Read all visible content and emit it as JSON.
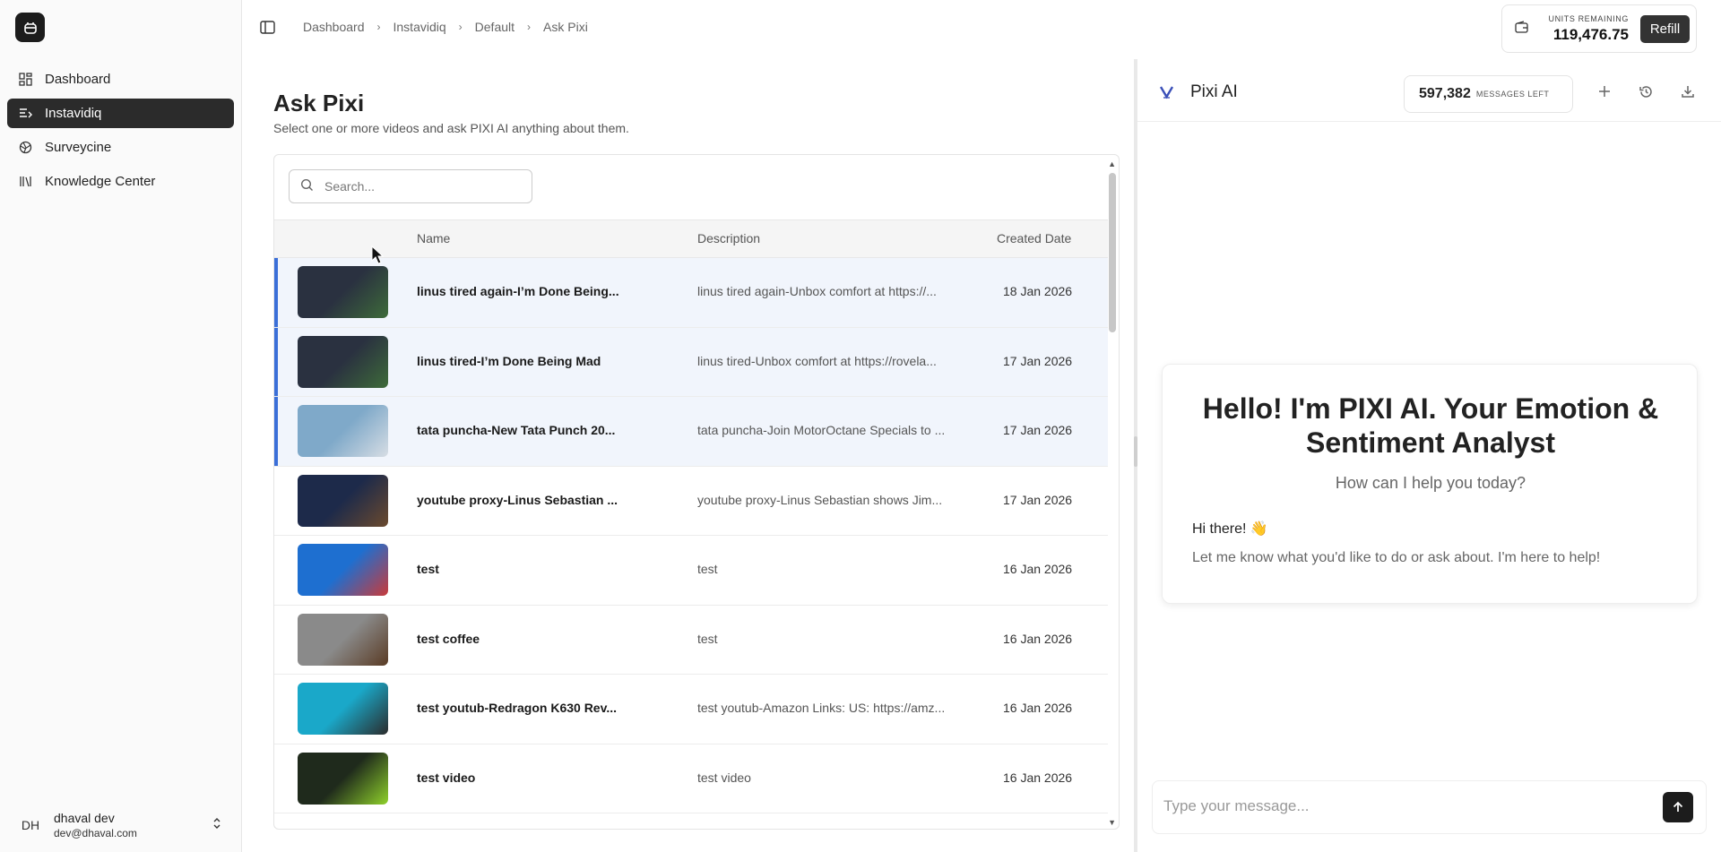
{
  "sidebar": {
    "items": [
      {
        "label": "Dashboard",
        "icon": "dashboard-icon"
      },
      {
        "label": "Instavidiq",
        "icon": "list-icon",
        "active": true
      },
      {
        "label": "Surveycine",
        "icon": "globe-icon"
      },
      {
        "label": "Knowledge Center",
        "icon": "library-icon"
      }
    ],
    "user": {
      "initials": "DH",
      "name": "dhaval dev",
      "email": "dev@dhaval.com"
    }
  },
  "breadcrumb": [
    "Dashboard",
    "Instavidiq",
    "Default",
    "Ask Pixi"
  ],
  "units": {
    "label": "UNITS REMAINING",
    "value": "119,476.75",
    "refill_label": "Refill"
  },
  "page": {
    "title": "Ask Pixi",
    "subtitle": "Select one or more videos and ask PIXI AI anything about them."
  },
  "search": {
    "placeholder": "Search..."
  },
  "table": {
    "columns": [
      "Name",
      "Description",
      "Created Date"
    ],
    "rows": [
      {
        "name": "linus tired again-I’m Done Being...",
        "description": "linus tired again-Unbox comfort at https://...",
        "date": "18 Jan 2026",
        "selected": true,
        "thumb_colors": [
          "#2a3140",
          "#3e6b3a"
        ]
      },
      {
        "name": "linus tired-I’m Done Being Mad",
        "description": "linus tired-Unbox comfort at https://rovela...",
        "date": "17 Jan 2026",
        "selected": true,
        "thumb_colors": [
          "#2a3140",
          "#3e6b3a"
        ]
      },
      {
        "name": "tata puncha-New Tata Punch 20...",
        "description": "tata puncha-Join MotorOctane Specials to ...",
        "date": "17 Jan 2026",
        "selected": true,
        "thumb_colors": [
          "#7fa9c9",
          "#d7dde4"
        ]
      },
      {
        "name": "youtube proxy-Linus Sebastian ...",
        "description": "youtube proxy-Linus Sebastian shows Jim...",
        "date": "17 Jan 2026",
        "selected": false,
        "thumb_colors": [
          "#1d2a4a",
          "#6b4a2e"
        ]
      },
      {
        "name": "test",
        "description": "test",
        "date": "16 Jan 2026",
        "selected": false,
        "thumb_colors": [
          "#1e6fd0",
          "#c93a3a"
        ]
      },
      {
        "name": "test coffee",
        "description": "test",
        "date": "16 Jan 2026",
        "selected": false,
        "thumb_colors": [
          "#8a8a8a",
          "#5a3b24"
        ]
      },
      {
        "name": "test youtub-Redragon K630 Rev...",
        "description": "test youtub-Amazon Links: US: https://amz...",
        "date": "16 Jan 2026",
        "selected": false,
        "thumb_colors": [
          "#1aa8c9",
          "#2b2b2b"
        ]
      },
      {
        "name": "test video",
        "description": "test video",
        "date": "16 Jan 2026",
        "selected": false,
        "thumb_colors": [
          "#1f2a1c",
          "#8fd12b"
        ]
      }
    ]
  },
  "chat": {
    "title": "Pixi AI",
    "messages_count": "597,382",
    "messages_label": "MESSAGES LEFT",
    "welcome_title": "Hello! I'm PIXI AI. Your Emotion & Sentiment Analyst",
    "welcome_sub": "How can I help you today?",
    "greeting": "Hi there! 👋",
    "greeting_msg": "Let me know what you'd like to do or ask about. I'm here to help!",
    "input_placeholder": "Type your message..."
  }
}
